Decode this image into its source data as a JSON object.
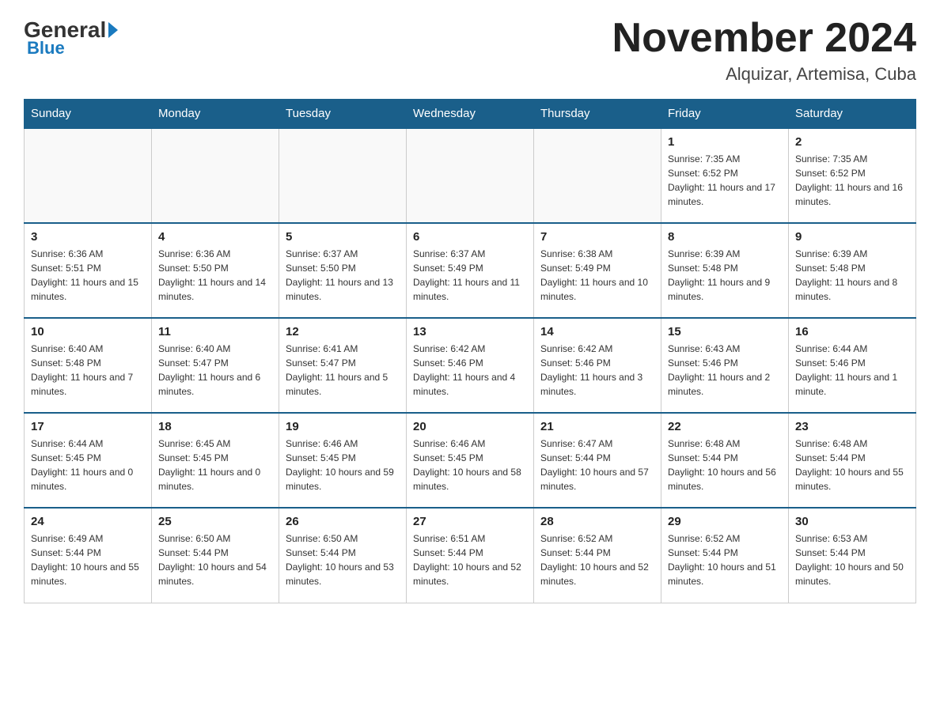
{
  "logo": {
    "general": "General",
    "blue": "Blue"
  },
  "title": "November 2024",
  "subtitle": "Alquizar, Artemisa, Cuba",
  "days_of_week": [
    "Sunday",
    "Monday",
    "Tuesday",
    "Wednesday",
    "Thursday",
    "Friday",
    "Saturday"
  ],
  "weeks": [
    [
      {
        "day": "",
        "info": ""
      },
      {
        "day": "",
        "info": ""
      },
      {
        "day": "",
        "info": ""
      },
      {
        "day": "",
        "info": ""
      },
      {
        "day": "",
        "info": ""
      },
      {
        "day": "1",
        "info": "Sunrise: 7:35 AM\nSunset: 6:52 PM\nDaylight: 11 hours and 17 minutes."
      },
      {
        "day": "2",
        "info": "Sunrise: 7:35 AM\nSunset: 6:52 PM\nDaylight: 11 hours and 16 minutes."
      }
    ],
    [
      {
        "day": "3",
        "info": "Sunrise: 6:36 AM\nSunset: 5:51 PM\nDaylight: 11 hours and 15 minutes."
      },
      {
        "day": "4",
        "info": "Sunrise: 6:36 AM\nSunset: 5:50 PM\nDaylight: 11 hours and 14 minutes."
      },
      {
        "day": "5",
        "info": "Sunrise: 6:37 AM\nSunset: 5:50 PM\nDaylight: 11 hours and 13 minutes."
      },
      {
        "day": "6",
        "info": "Sunrise: 6:37 AM\nSunset: 5:49 PM\nDaylight: 11 hours and 11 minutes."
      },
      {
        "day": "7",
        "info": "Sunrise: 6:38 AM\nSunset: 5:49 PM\nDaylight: 11 hours and 10 minutes."
      },
      {
        "day": "8",
        "info": "Sunrise: 6:39 AM\nSunset: 5:48 PM\nDaylight: 11 hours and 9 minutes."
      },
      {
        "day": "9",
        "info": "Sunrise: 6:39 AM\nSunset: 5:48 PM\nDaylight: 11 hours and 8 minutes."
      }
    ],
    [
      {
        "day": "10",
        "info": "Sunrise: 6:40 AM\nSunset: 5:48 PM\nDaylight: 11 hours and 7 minutes."
      },
      {
        "day": "11",
        "info": "Sunrise: 6:40 AM\nSunset: 5:47 PM\nDaylight: 11 hours and 6 minutes."
      },
      {
        "day": "12",
        "info": "Sunrise: 6:41 AM\nSunset: 5:47 PM\nDaylight: 11 hours and 5 minutes."
      },
      {
        "day": "13",
        "info": "Sunrise: 6:42 AM\nSunset: 5:46 PM\nDaylight: 11 hours and 4 minutes."
      },
      {
        "day": "14",
        "info": "Sunrise: 6:42 AM\nSunset: 5:46 PM\nDaylight: 11 hours and 3 minutes."
      },
      {
        "day": "15",
        "info": "Sunrise: 6:43 AM\nSunset: 5:46 PM\nDaylight: 11 hours and 2 minutes."
      },
      {
        "day": "16",
        "info": "Sunrise: 6:44 AM\nSunset: 5:46 PM\nDaylight: 11 hours and 1 minute."
      }
    ],
    [
      {
        "day": "17",
        "info": "Sunrise: 6:44 AM\nSunset: 5:45 PM\nDaylight: 11 hours and 0 minutes."
      },
      {
        "day": "18",
        "info": "Sunrise: 6:45 AM\nSunset: 5:45 PM\nDaylight: 11 hours and 0 minutes."
      },
      {
        "day": "19",
        "info": "Sunrise: 6:46 AM\nSunset: 5:45 PM\nDaylight: 10 hours and 59 minutes."
      },
      {
        "day": "20",
        "info": "Sunrise: 6:46 AM\nSunset: 5:45 PM\nDaylight: 10 hours and 58 minutes."
      },
      {
        "day": "21",
        "info": "Sunrise: 6:47 AM\nSunset: 5:44 PM\nDaylight: 10 hours and 57 minutes."
      },
      {
        "day": "22",
        "info": "Sunrise: 6:48 AM\nSunset: 5:44 PM\nDaylight: 10 hours and 56 minutes."
      },
      {
        "day": "23",
        "info": "Sunrise: 6:48 AM\nSunset: 5:44 PM\nDaylight: 10 hours and 55 minutes."
      }
    ],
    [
      {
        "day": "24",
        "info": "Sunrise: 6:49 AM\nSunset: 5:44 PM\nDaylight: 10 hours and 55 minutes."
      },
      {
        "day": "25",
        "info": "Sunrise: 6:50 AM\nSunset: 5:44 PM\nDaylight: 10 hours and 54 minutes."
      },
      {
        "day": "26",
        "info": "Sunrise: 6:50 AM\nSunset: 5:44 PM\nDaylight: 10 hours and 53 minutes."
      },
      {
        "day": "27",
        "info": "Sunrise: 6:51 AM\nSunset: 5:44 PM\nDaylight: 10 hours and 52 minutes."
      },
      {
        "day": "28",
        "info": "Sunrise: 6:52 AM\nSunset: 5:44 PM\nDaylight: 10 hours and 52 minutes."
      },
      {
        "day": "29",
        "info": "Sunrise: 6:52 AM\nSunset: 5:44 PM\nDaylight: 10 hours and 51 minutes."
      },
      {
        "day": "30",
        "info": "Sunrise: 6:53 AM\nSunset: 5:44 PM\nDaylight: 10 hours and 50 minutes."
      }
    ]
  ]
}
